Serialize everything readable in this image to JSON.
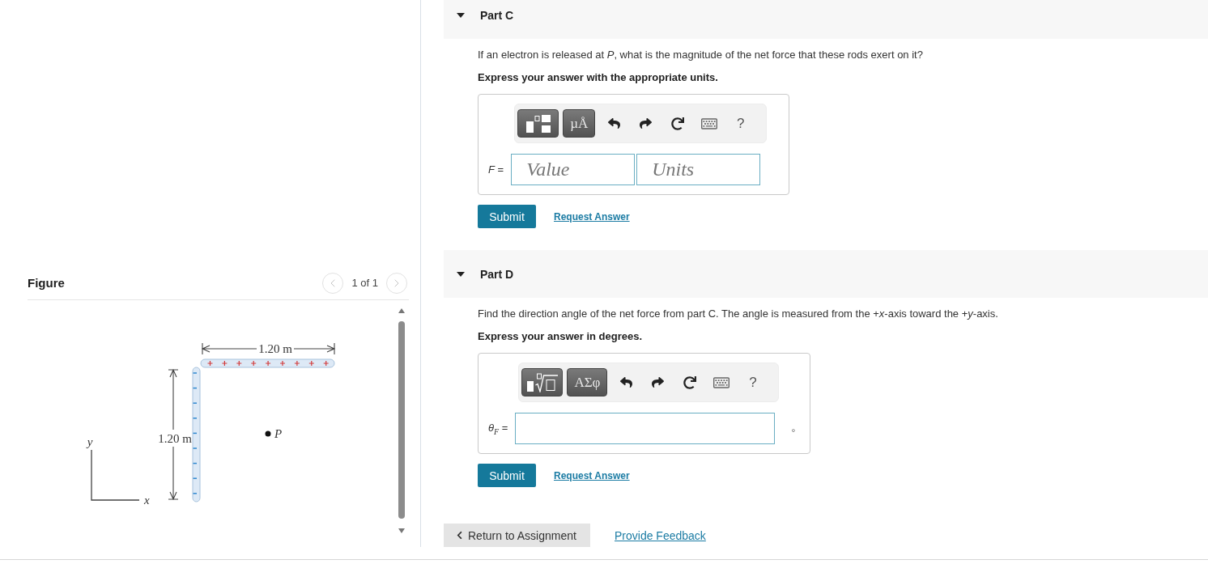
{
  "figure_panel": {
    "title": "Figure",
    "pager": {
      "label": "1 of 1",
      "previous": {
        "disabled": true
      },
      "next": {
        "disabled": true
      }
    },
    "figure": {
      "top_dimension": "1.20 m",
      "side_dimension": "1.20 m",
      "point_label": "P",
      "x_axis": "x",
      "y_axis": "y"
    }
  },
  "parts": [
    {
      "title": "Part C",
      "expanded": true,
      "question": "If an electron is released at *P*, what is the magnitude of the net force that these rods exert on it?",
      "instruction": "Express your answer with the appropriate units.",
      "answer": {
        "kind": "value_units",
        "label": "*F* =",
        "tools": [
          {
            "kind": "fraction_template"
          },
          {
            "kind": "symbols",
            "label": "µÅ"
          },
          {
            "kind": "undo"
          },
          {
            "kind": "redo"
          },
          {
            "kind": "reset"
          },
          {
            "kind": "keyboard"
          },
          {
            "kind": "help",
            "label": "?"
          }
        ],
        "fields": [
          {
            "placeholder": "Value"
          },
          {
            "placeholder": "Units"
          }
        ]
      },
      "submit": "Submit",
      "request_answer": "Request Answer"
    },
    {
      "title": "Part D",
      "expanded": true,
      "question": "Find the direction angle of the net force from part C. The angle is measured from the +*x*-axis toward the +*y*-axis.",
      "instruction": "Express your answer in degrees.",
      "answer": {
        "kind": "value_unit",
        "label": "*θ*$_{F}$ =",
        "tools": [
          {
            "kind": "radical_template"
          },
          {
            "kind": "symbols",
            "label": "ΑΣφ"
          },
          {
            "kind": "undo"
          },
          {
            "kind": "redo"
          },
          {
            "kind": "reset"
          },
          {
            "kind": "keyboard"
          },
          {
            "kind": "help",
            "label": "?"
          }
        ],
        "unit": "°"
      },
      "submit": "Submit",
      "request_answer": "Request Answer"
    }
  ],
  "footer": {
    "return_button": "Return to Assignment",
    "feedback_link": "Provide Feedback"
  }
}
